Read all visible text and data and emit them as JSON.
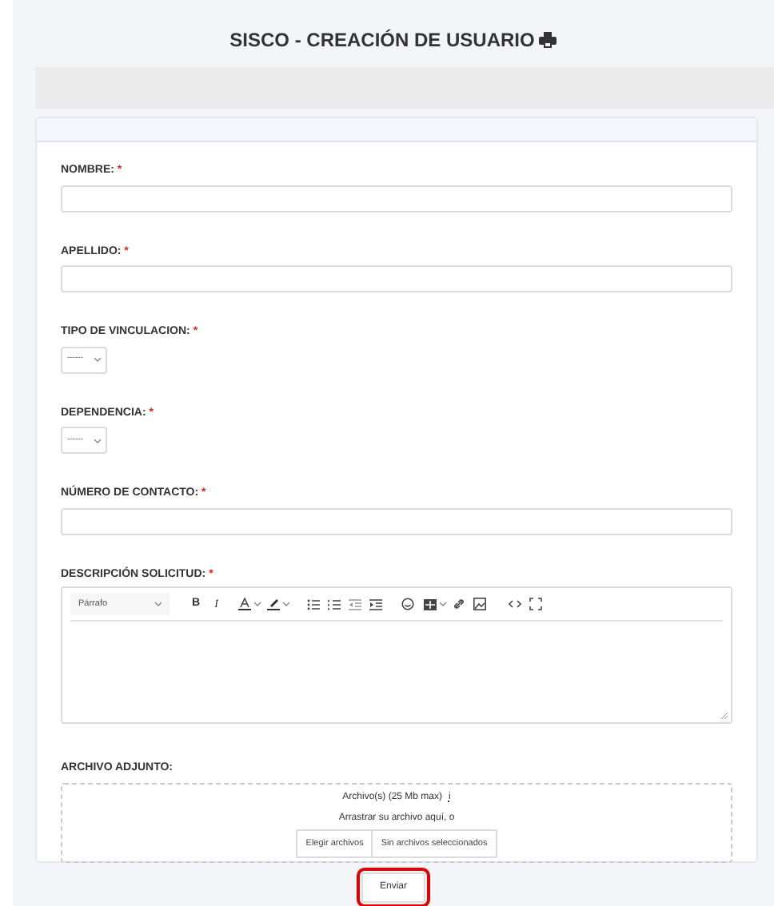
{
  "header": {
    "title": "SISCO - CREACIÓN DE USUARIO"
  },
  "fields": [
    {
      "kind": "text",
      "label": "NOMBRE:",
      "marker": "*"
    },
    {
      "kind": "text",
      "label": "APELLIDO:",
      "marker": "*"
    },
    {
      "kind": "select",
      "label": "TIPO DE VINCULACION:",
      "marker": "*",
      "value": "------"
    },
    {
      "kind": "select",
      "label": "DEPENDENCIA:",
      "marker": "*",
      "value": "------"
    },
    {
      "kind": "text",
      "label": "NÚMERO DE CONTACTO:",
      "marker": "*"
    },
    {
      "kind": "editor",
      "label": "DESCRIPCIÓN SOLICITUD:",
      "marker": "*",
      "format": "Párrafo",
      "bold": "B",
      "italic": "I"
    },
    {
      "kind": "file",
      "label": "ARCHIVO ADJUNTO:",
      "limit": "Archivo(s) (25 Mb max)",
      "info": "i",
      "hint": "Arrastrar su archivo aquí, o",
      "choose": "Elegir archivos",
      "status": "Sin archivos seleccionados"
    }
  ],
  "submit": {
    "label": "Enviar",
    "highlighted": true
  }
}
